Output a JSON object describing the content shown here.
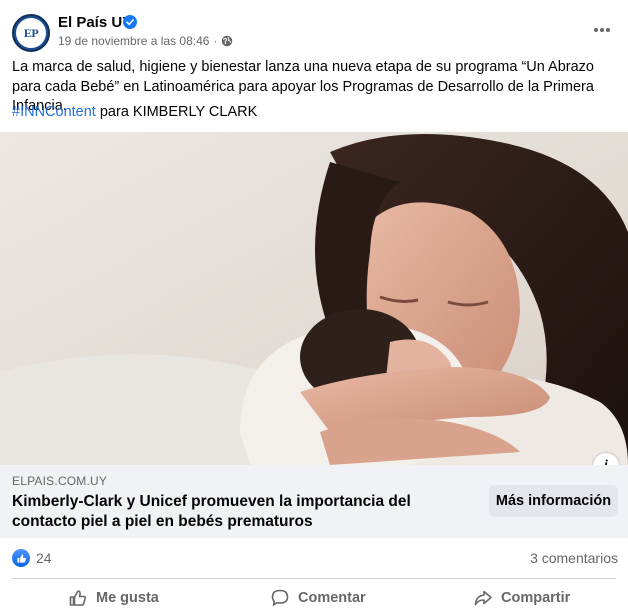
{
  "post": {
    "author": "El País UY",
    "avatar_text": "EP",
    "timestamp": "19 de noviembre a las 08:46",
    "separator": "·",
    "body": "La marca de salud, higiene y bienestar lanza una nueva etapa de su programa “Un Abrazo para cada Bebé” en Latinoamérica para apoyar los Programas de Desarrollo de la Primera Infancia.",
    "hashtag": "#INNContent",
    "tagline_rest": " para KIMBERLY CLARK"
  },
  "link_preview": {
    "domain": "ELPAIS.COM.UY",
    "title": "Kimberly-Clark y Unicef promueven la importancia del contacto piel a piel en bebés prematuros",
    "cta": "Más información",
    "info_glyph": "i"
  },
  "engagement": {
    "reaction_count": "24",
    "comments": "3 comentarios"
  },
  "actions": {
    "like": "Me gusta",
    "comment": "Comentar",
    "share": "Compartir"
  },
  "colors": {
    "link_blue": "#216fdb",
    "brand_blue": "#1d4f91",
    "muted": "#65676b",
    "verified": "#1877f2"
  },
  "icons": [
    "verified-icon",
    "globe-icon",
    "more-options-icon",
    "info-icon",
    "like-reaction-icon",
    "like-icon",
    "comment-icon",
    "share-icon"
  ]
}
